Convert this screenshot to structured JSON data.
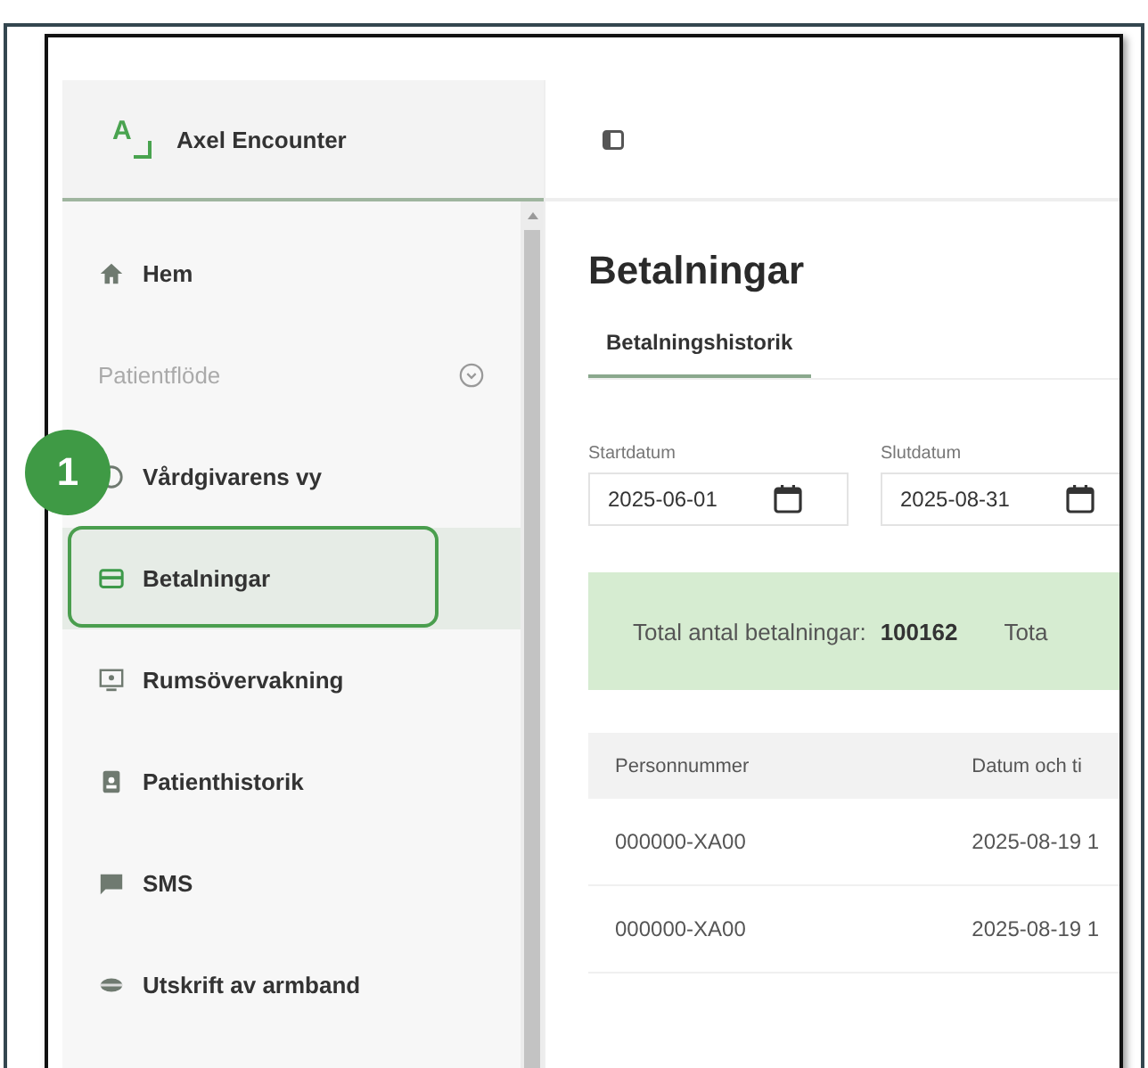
{
  "app": {
    "name": "Axel Encounter",
    "logo": "A"
  },
  "sidebar": {
    "items": [
      {
        "label": "Hem",
        "kind": "link",
        "selected": false
      },
      {
        "label": "Patientflöde",
        "kind": "group",
        "selected": false
      },
      {
        "label": "Vårdgivarens vy",
        "kind": "link",
        "selected": false
      },
      {
        "label": "Betalningar",
        "kind": "link",
        "selected": true
      },
      {
        "label": "Rumsövervakning",
        "kind": "link",
        "selected": false
      },
      {
        "label": "Patienthistorik",
        "kind": "link",
        "selected": false
      },
      {
        "label": "SMS",
        "kind": "link",
        "selected": false
      },
      {
        "label": "Utskrift av armband",
        "kind": "link",
        "selected": false
      }
    ]
  },
  "callout": {
    "number": "1"
  },
  "page": {
    "title": "Betalningar"
  },
  "tabs": [
    {
      "label": "Betalningshistorik",
      "selected": true
    }
  ],
  "date_fields": [
    {
      "label": "Startdatum",
      "value": "2025-06-01"
    },
    {
      "label": "Slutdatum",
      "value": "2025-08-31"
    }
  ],
  "summary": {
    "label": "Total antal betalningar:",
    "value": "100162",
    "next_label": "Tota"
  },
  "table": {
    "columns": [
      "Personnummer",
      "Datum och ti"
    ],
    "rows": [
      [
        "000000-XA00",
        "2025-08-19 1"
      ],
      [
        "000000-XA00",
        "2025-08-19 1"
      ]
    ]
  }
}
